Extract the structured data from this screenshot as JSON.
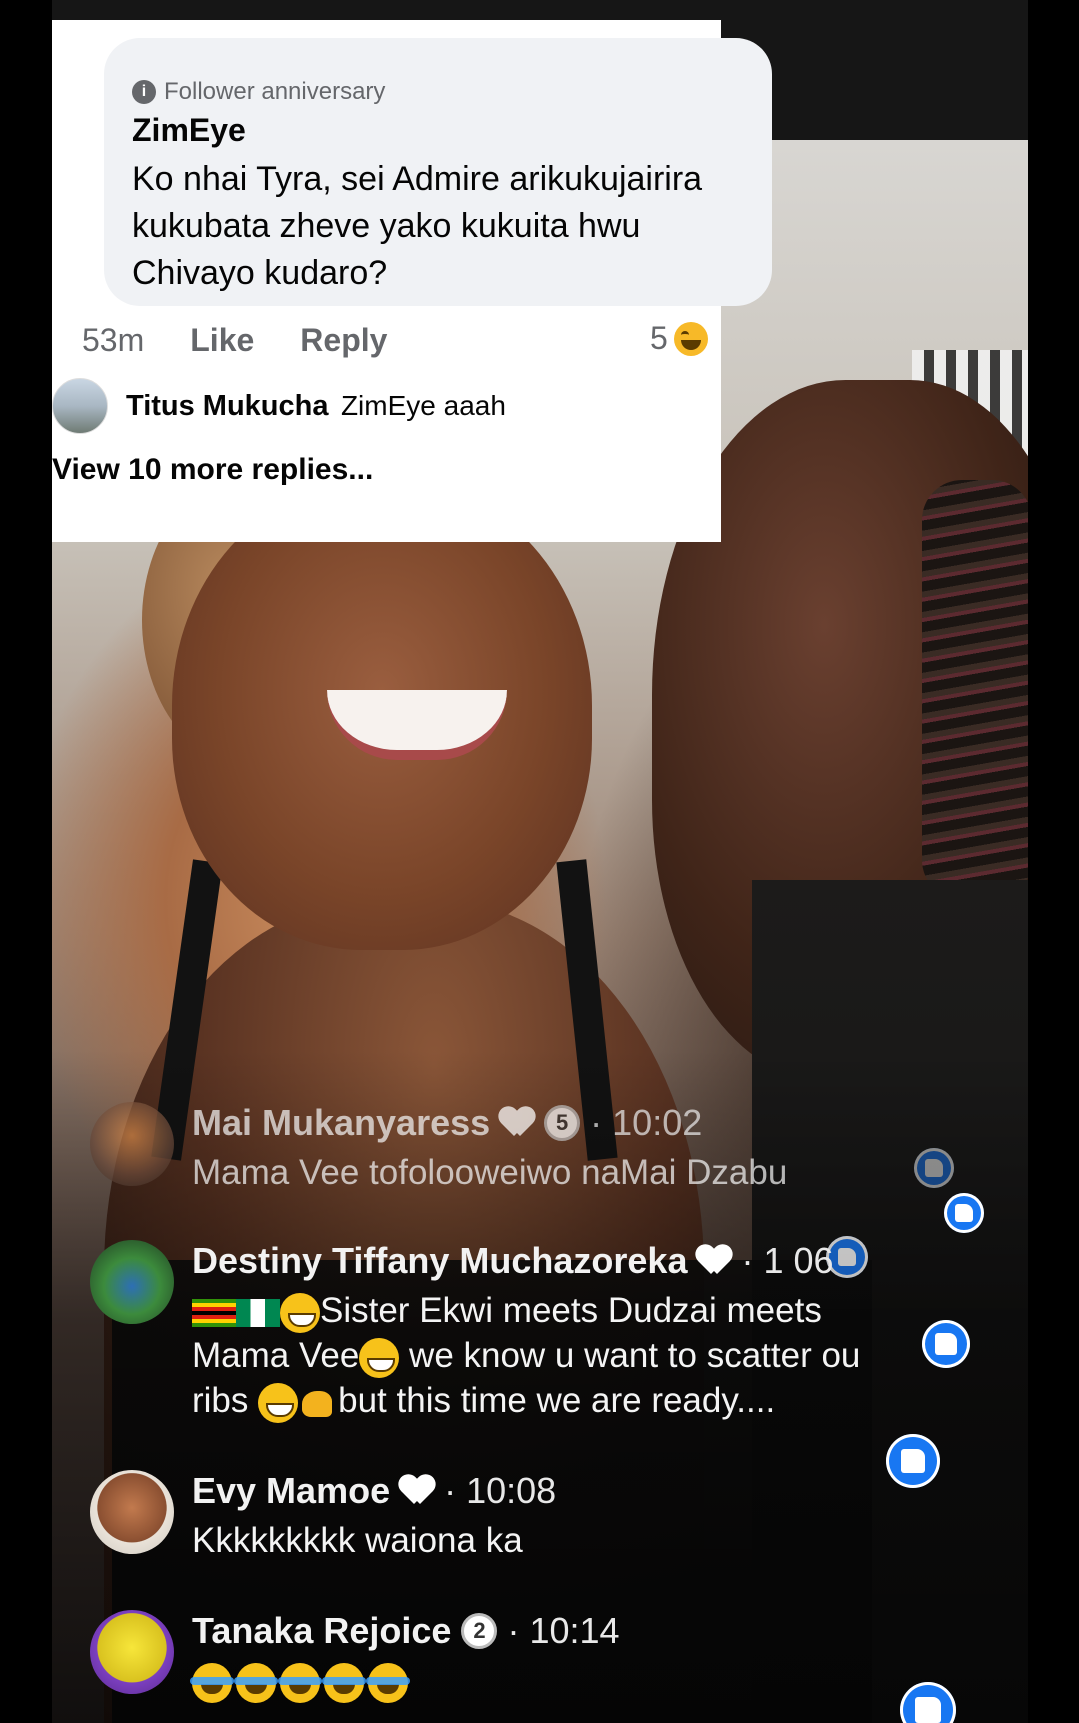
{
  "colors": {
    "fb_blue": "#1877f2",
    "fb_gray_text": "#65676b",
    "bubble_bg": "#f0f2f5"
  },
  "fb_comment": {
    "badge_icon": "info-icon",
    "badge_label": "Follower anniversary",
    "author": "ZimEye",
    "text": "Ko nhai Tyra, sei Admire arikukujairira kukubata zheve yako kukuita hwu Chivayo kudaro?",
    "time": "53m",
    "like_label": "Like",
    "reply_label": "Reply",
    "reaction_count": "5",
    "reaction_icon": "laughing-emoji-icon",
    "reply": {
      "name": "Titus Mukucha",
      "text": "ZimEye aaah"
    },
    "view_more_label": "View 10 more replies..."
  },
  "live_comments": [
    {
      "name": "Mai Mukanyaress",
      "badge_num": "5",
      "time": "10:02",
      "text": "Mama Vee tofoloowеiwo naMai Dzabu"
    },
    {
      "name": "Destiny Tiffany Muchazoreka",
      "time": "1  06",
      "line1": "Sister Ekwi meets Dudzai meets",
      "line2a": "Mama Vee",
      "line2b": " we know u want to scatter ou",
      "line3a": "ribs ",
      "line3b": "but this time we are ready...."
    },
    {
      "name": "Evy Mamoe",
      "time": "10:08",
      "text": "Kkkkkkkkk waiona ka"
    },
    {
      "name": "Tanaka Rejoice",
      "badge_num": "2",
      "time": "10:14"
    }
  ]
}
